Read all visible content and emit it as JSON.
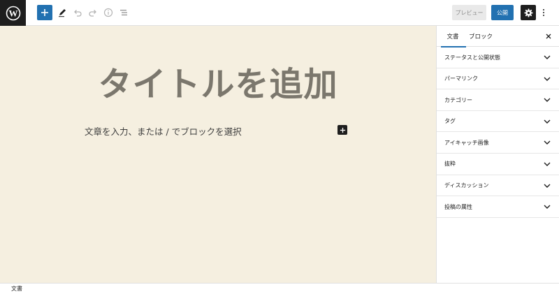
{
  "toolbar": {
    "preview_label": "プレビュー",
    "publish_label": "公開"
  },
  "editor": {
    "title_placeholder": "タイトルを追加",
    "block_placeholder": "文章を入力、または / でブロックを選択"
  },
  "sidebar": {
    "tabs": [
      {
        "label": "文書",
        "active": true
      },
      {
        "label": "ブロック",
        "active": false
      }
    ],
    "panels": [
      {
        "label": "ステータスと公開状態"
      },
      {
        "label": "パーマリンク"
      },
      {
        "label": "カテゴリー"
      },
      {
        "label": "タグ"
      },
      {
        "label": "アイキャッチ画像"
      },
      {
        "label": "抜粋"
      },
      {
        "label": "ディスカッション"
      },
      {
        "label": "投稿の属性"
      }
    ]
  },
  "footer": {
    "breadcrumb": "文書"
  },
  "colors": {
    "accent": "#2271b1",
    "dark": "#1e1e1e",
    "canvas_bg": "#f5efe0",
    "title_color": "#7b776d"
  },
  "icons": [
    "wordpress-logo",
    "plus",
    "pencil",
    "undo",
    "redo",
    "info",
    "list-view",
    "gear",
    "more-vertical",
    "close",
    "chevron-down"
  ]
}
